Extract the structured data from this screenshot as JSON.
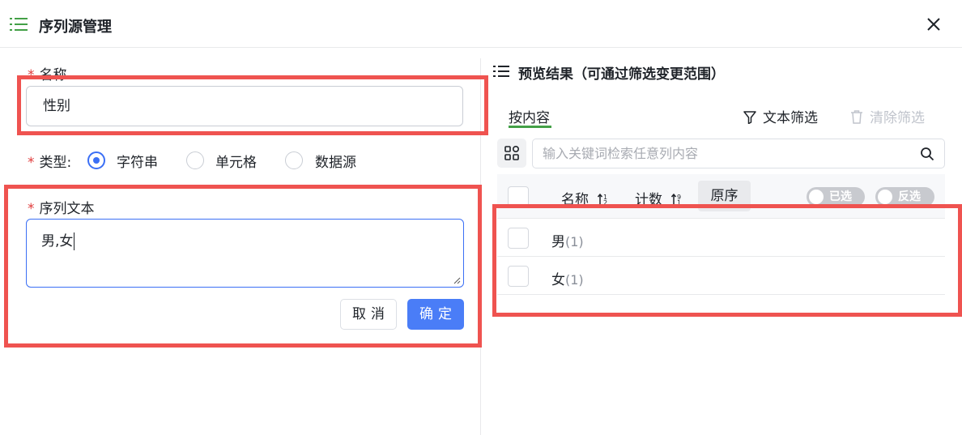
{
  "dialog": {
    "title": "序列源管理",
    "close_icon": "close-icon"
  },
  "form": {
    "name_label": "名称",
    "name_value": "性别",
    "type_label": "类型:",
    "type_options": [
      "字符串",
      "单元格",
      "数据源"
    ],
    "type_selected": "字符串",
    "sequence_label": "序列文本",
    "sequence_value": "男,女",
    "cancel_label": "取消",
    "confirm_label": "确定"
  },
  "preview": {
    "title": "预览结果（可通过筛选变更范围）",
    "tab_label": "按内容",
    "text_filter_label": "文本筛选",
    "clear_filter_label": "清除筛选",
    "search_placeholder": "输入关键词检索任意列内容",
    "columns": {
      "name": "名称",
      "count": "计数",
      "order": "原序"
    },
    "toggles": {
      "selected": "已选",
      "inverse": "反选"
    },
    "rows": [
      {
        "label": "男",
        "count": "(1)"
      },
      {
        "label": "女",
        "count": "(1)"
      }
    ]
  },
  "colors": {
    "primary": "#4a7df7",
    "highlight": "#ef5350",
    "tab_underline": "#43a047",
    "required": "#e03b3b"
  }
}
